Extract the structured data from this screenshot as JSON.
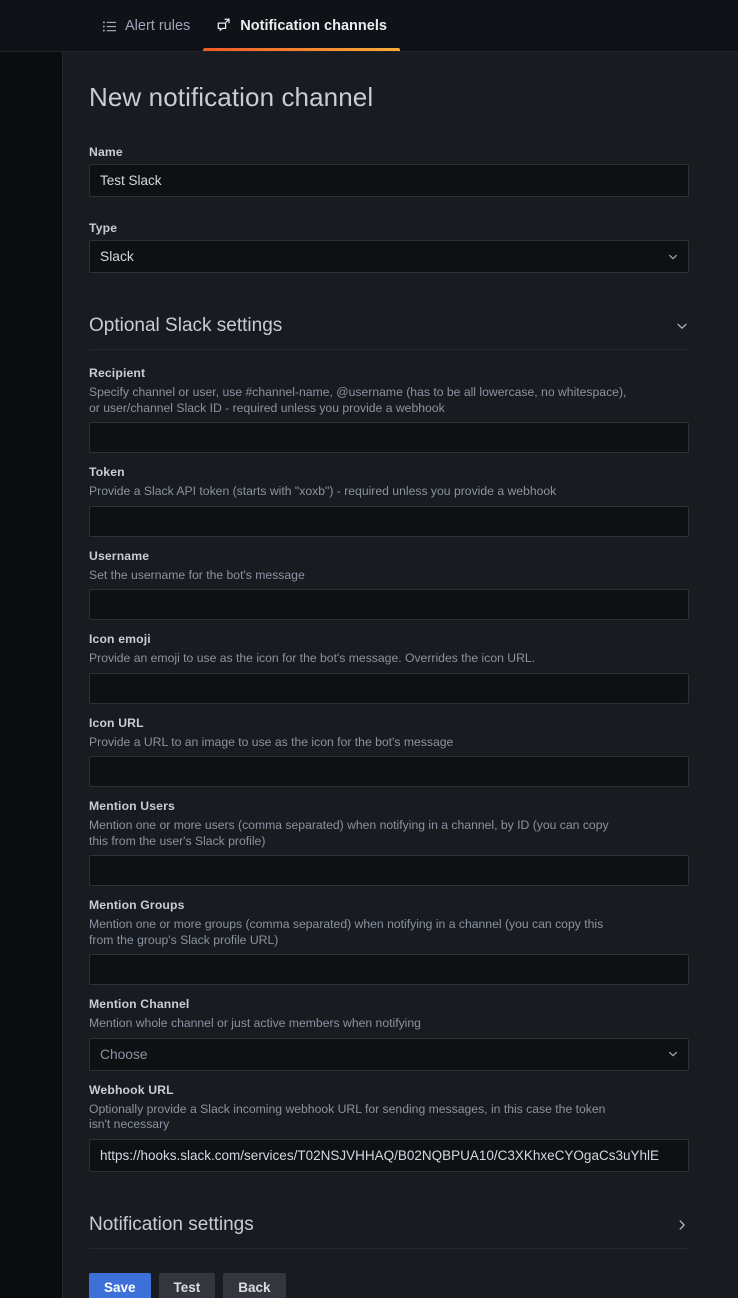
{
  "tabs": [
    {
      "id": "alert-rules",
      "label": "Alert rules",
      "icon": "list-icon",
      "active": false
    },
    {
      "id": "notification-channels",
      "label": "Notification channels",
      "icon": "comment-share-icon",
      "active": true
    }
  ],
  "page": {
    "title": "New notification channel"
  },
  "form": {
    "name": {
      "label": "Name",
      "value": "Test Slack",
      "placeholder": ""
    },
    "type": {
      "label": "Type",
      "value": "Slack"
    }
  },
  "optional_section": {
    "title": "Optional Slack settings",
    "expanded": true,
    "chevron": "chevron-down-icon",
    "fields": [
      {
        "id": "recipient",
        "label": "Recipient",
        "description": "Specify channel or user, use #channel-name, @username (has to be all lowercase, no whitespace), or user/channel Slack ID - required unless you provide a webhook",
        "control": "text",
        "value": "",
        "placeholder": ""
      },
      {
        "id": "token",
        "label": "Token",
        "description": "Provide a Slack API token (starts with \"xoxb\") - required unless you provide a webhook",
        "control": "text",
        "value": "",
        "placeholder": ""
      },
      {
        "id": "username",
        "label": "Username",
        "description": "Set the username for the bot's message",
        "control": "text",
        "value": "",
        "placeholder": ""
      },
      {
        "id": "icon-emoji",
        "label": "Icon emoji",
        "description": "Provide an emoji to use as the icon for the bot's message. Overrides the icon URL.",
        "control": "text",
        "value": "",
        "placeholder": ""
      },
      {
        "id": "icon-url",
        "label": "Icon URL",
        "description": "Provide a URL to an image to use as the icon for the bot's message",
        "control": "text",
        "value": "",
        "placeholder": ""
      },
      {
        "id": "mention-users",
        "label": "Mention Users",
        "description": "Mention one or more users (comma separated) when notifying in a channel, by ID (you can copy this from the user's Slack profile)",
        "control": "text",
        "value": "",
        "placeholder": ""
      },
      {
        "id": "mention-groups",
        "label": "Mention Groups",
        "description": "Mention one or more groups (comma separated) when notifying in a channel (you can copy this from the group's Slack profile URL)",
        "control": "text",
        "value": "",
        "placeholder": ""
      },
      {
        "id": "mention-channel",
        "label": "Mention Channel",
        "description": "Mention whole channel or just active members when notifying",
        "control": "select",
        "value": "Choose",
        "is_placeholder": true,
        "chevron": "chevron-down-icon"
      },
      {
        "id": "webhook-url",
        "label": "Webhook URL",
        "description": "Optionally provide a Slack incoming webhook URL for sending messages, in this case the token isn't necessary",
        "control": "text",
        "value": "https://hooks.slack.com/services/T02NSJVHHAQ/B02NQBPUA10/C3XKhxeCYOgaCs3uYhlE",
        "placeholder": ""
      }
    ]
  },
  "notification_section": {
    "title": "Notification settings",
    "expanded": false,
    "chevron": "chevron-right-icon"
  },
  "actions": {
    "save": "Save",
    "test": "Test",
    "back": "Back"
  },
  "colors": {
    "accent_tab": "#f05a28",
    "primary_button": "#3d71d9",
    "secondary_button": "#33373d",
    "panel_bg": "#181b1f",
    "page_bg": "#0b0c0e",
    "input_bg": "#0e1013",
    "input_border": "#2c3235"
  }
}
